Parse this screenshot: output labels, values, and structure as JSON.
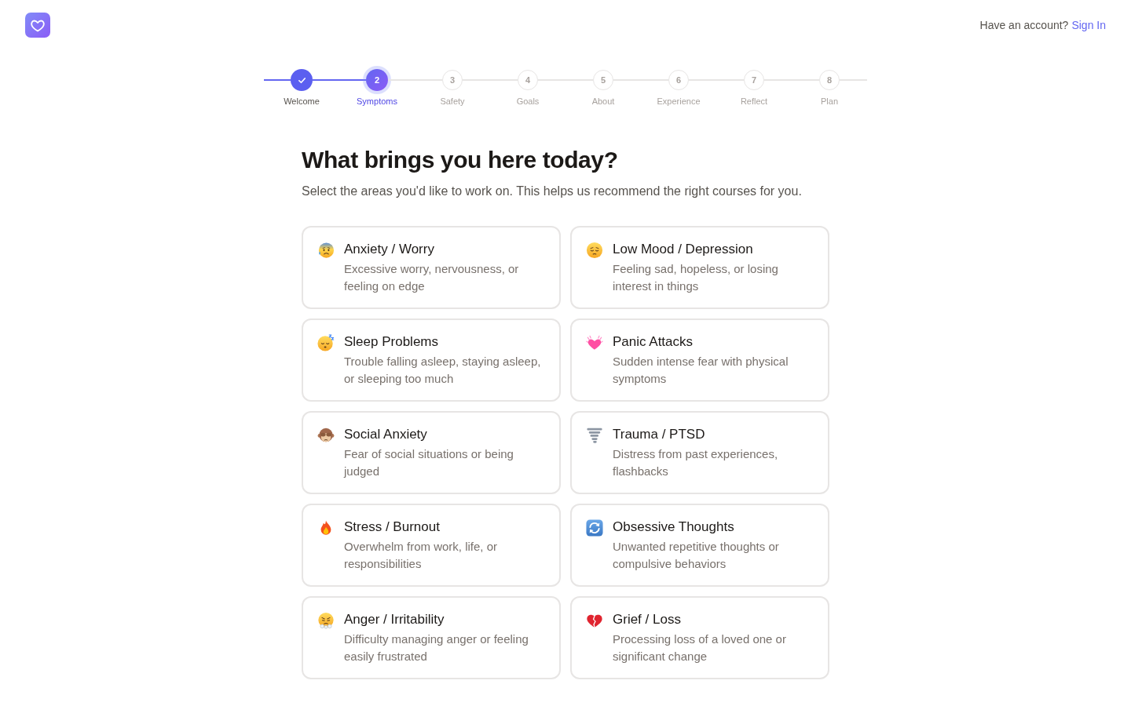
{
  "header": {
    "prompt": "Have an account?",
    "link": "Sign In"
  },
  "steps": [
    {
      "label": "Welcome",
      "completed": true,
      "selected": false
    },
    {
      "number": "2",
      "label": "Symptoms",
      "completed": false,
      "selected": true
    },
    {
      "number": "3",
      "label": "Safety",
      "completed": false,
      "selected": false
    },
    {
      "number": "4",
      "label": "Goals",
      "completed": false,
      "selected": false
    },
    {
      "number": "5",
      "label": "About",
      "completed": false,
      "selected": false
    },
    {
      "number": "6",
      "label": "Experience",
      "completed": false,
      "selected": false
    },
    {
      "number": "7",
      "label": "Reflect",
      "completed": false,
      "selected": false
    },
    {
      "number": "8",
      "label": "Plan",
      "completed": false,
      "selected": false
    }
  ],
  "title": "What brings you here today?",
  "subtitle": "Select the areas you'd like to work on. This helps us recommend the right courses for you.",
  "cards": [
    {
      "title": "Anxiety / Worry",
      "description": "Excessive worry, nervousness, or feeling on edge",
      "selected": false
    },
    {
      "title": "Low Mood / Depression",
      "description": "Feeling sad, hopeless, or losing interest in things",
      "selected": false
    },
    {
      "title": "Sleep Problems",
      "description": "Trouble falling asleep, staying asleep, or sleeping too much",
      "selected": false
    },
    {
      "title": "Panic Attacks",
      "description": "Sudden intense fear with physical symptoms",
      "selected": false
    },
    {
      "title": "Social Anxiety",
      "description": "Fear of social situations or being judged",
      "selected": false
    },
    {
      "title": "Trauma / PTSD",
      "description": "Distress from past experiences, flashbacks",
      "selected": false
    },
    {
      "title": "Stress / Burnout",
      "description": "Overwhelm from work, life, or responsibilities",
      "selected": false
    },
    {
      "title": "Obsessive Thoughts",
      "description": "Unwanted repetitive thoughts or compulsive behaviors",
      "selected": false
    },
    {
      "title": "Anger / Irritability",
      "description": "Difficulty managing anger or feeling easily frustrated",
      "selected": false
    },
    {
      "title": "Grief / Loss",
      "description": "Processing loss of a loved one or significant change",
      "selected": false
    }
  ]
}
